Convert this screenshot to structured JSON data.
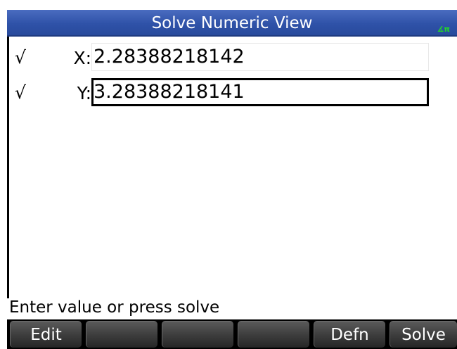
{
  "title": "Solve Numeric View",
  "angle_indicator": "∡π",
  "variables": [
    {
      "checked": true,
      "check_glyph": "√",
      "label": "X:",
      "value": "2.28388218142"
    },
    {
      "checked": true,
      "check_glyph": "√",
      "label": "Y:",
      "value": "3.28388218141"
    }
  ],
  "prompt": "Enter value or press solve",
  "menu": {
    "keys": [
      "Edit",
      "",
      "",
      "",
      "Defn",
      "Solve"
    ]
  },
  "colors": {
    "title_bar": "#2f52a8",
    "title_text": "#ffffff",
    "angle_indicator": "#22dd22",
    "menu_key": "#3e3e3e"
  }
}
